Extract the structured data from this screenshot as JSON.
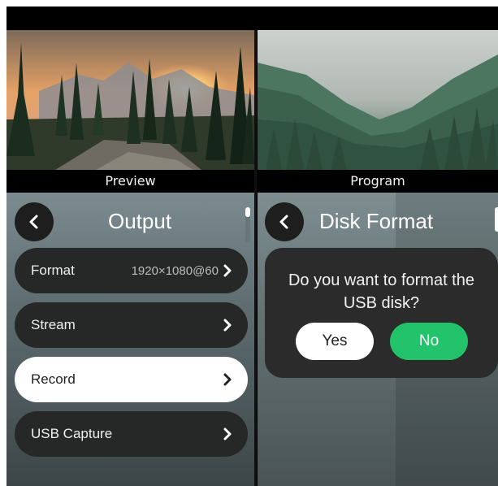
{
  "preview": {
    "caption": "Preview",
    "image_icon": "sunset-forest-mountain-image"
  },
  "program": {
    "caption": "Program",
    "image_icon": "misty-forest-image"
  },
  "output_menu": {
    "title": "Output",
    "back_icon": "chevron-left-icon",
    "items": [
      {
        "label": "Format",
        "value": "1920×1080@60",
        "selected": false
      },
      {
        "label": "Stream",
        "value": "",
        "selected": false
      },
      {
        "label": "Record",
        "value": "",
        "selected": true
      },
      {
        "label": "USB Capture",
        "value": "",
        "selected": false
      }
    ]
  },
  "disk_format": {
    "title": "Disk Format",
    "back_icon": "chevron-left-icon",
    "dialog": {
      "message_line1": "Do you want to format the",
      "message_line2": "USB disk?",
      "yes_label": "Yes",
      "no_label": "No"
    }
  },
  "colors": {
    "accent_green": "#22c36a",
    "button_dark": "#262727",
    "selected_white": "#ffffff"
  }
}
